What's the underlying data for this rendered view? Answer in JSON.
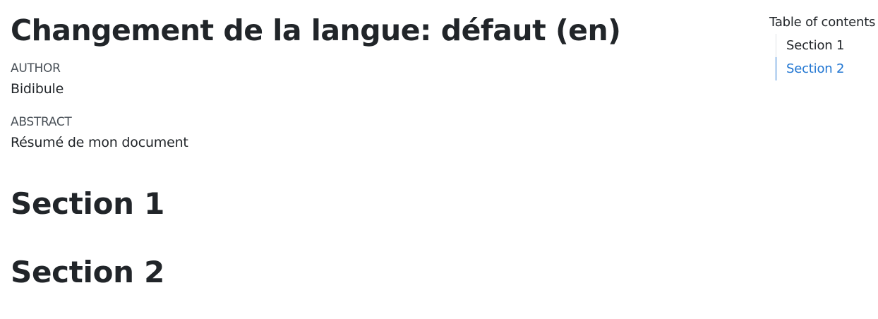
{
  "document": {
    "title": "Changement de la langue: défaut (en)",
    "author_heading": "Author",
    "author_name": "Bidibule",
    "abstract_heading": "Abstract",
    "abstract_text": "Résumé de mon document",
    "sections": [
      {
        "title": "Section 1"
      },
      {
        "title": "Section 2"
      }
    ]
  },
  "toc": {
    "title": "Table of contents",
    "items": [
      {
        "label": "Section 1",
        "active": false
      },
      {
        "label": "Section 2",
        "active": true
      }
    ]
  },
  "colors": {
    "text": "#212529",
    "muted": "#495057",
    "accent": "#2176d2"
  }
}
